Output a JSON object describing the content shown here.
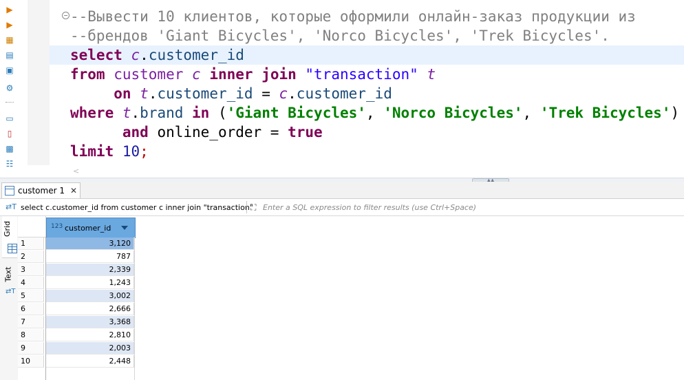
{
  "editor": {
    "lines": [
      [
        [
          "c-com",
          "--Вывести 10 клиентов, которые оформили онлайн-заказ продукции из"
        ]
      ],
      [
        [
          "c-com",
          "--брендов 'Giant Bicycles', 'Norco Bicycles', 'Trek Bicycles'."
        ]
      ],
      [
        [
          "c-kw",
          "select "
        ],
        [
          "c-al",
          "c"
        ],
        [
          "c-pl",
          "."
        ],
        [
          "c-fld",
          "customer_id"
        ]
      ],
      [
        [
          "c-kw",
          "from "
        ],
        [
          "c-tbl",
          "customer "
        ],
        [
          "c-al",
          "c "
        ],
        [
          "c-kw",
          "inner join "
        ],
        [
          "c-str",
          "\"transaction\" "
        ],
        [
          "c-al",
          "t"
        ]
      ],
      [
        [
          "c-pl",
          "     "
        ],
        [
          "c-kw",
          "on "
        ],
        [
          "c-al",
          "t"
        ],
        [
          "c-pl",
          "."
        ],
        [
          "c-fld",
          "customer_id"
        ],
        [
          "c-pl",
          " = "
        ],
        [
          "c-al",
          "c"
        ],
        [
          "c-pl",
          "."
        ],
        [
          "c-fld",
          "customer_id"
        ]
      ],
      [
        [
          "c-kw",
          "where "
        ],
        [
          "c-al",
          "t"
        ],
        [
          "c-pl",
          "."
        ],
        [
          "c-fld",
          "brand "
        ],
        [
          "c-kw",
          "in "
        ],
        [
          "c-pl",
          "("
        ],
        [
          "c-bstr",
          "'Giant Bicycles'"
        ],
        [
          "c-pl",
          ", "
        ],
        [
          "c-bstr",
          "'Norco Bicycles'"
        ],
        [
          "c-pl",
          ", "
        ],
        [
          "c-bstr",
          "'Trek Bicycles'"
        ],
        [
          "c-pl",
          ")"
        ]
      ],
      [
        [
          "c-pl",
          "      "
        ],
        [
          "c-kw",
          "and "
        ],
        [
          "c-pl",
          "online_order = "
        ],
        [
          "c-kw",
          "true"
        ]
      ],
      [
        [
          "c-kw",
          "limit "
        ],
        [
          "c-num",
          "10"
        ],
        [
          "c-red",
          ";"
        ]
      ]
    ]
  },
  "results": {
    "tab_label": "customer 1",
    "tab_close": "✕",
    "query_text": "select c.customer_id from customer c inner join \"transaction\"",
    "filter_placeholder": "Enter a SQL expression to filter results (use Ctrl+Space)",
    "side_tabs": {
      "grid": "Grid",
      "text": "Text"
    },
    "column_header": "customer_id",
    "column_type_icon": "123",
    "rows": [
      {
        "num": "1",
        "value": "3,120"
      },
      {
        "num": "2",
        "value": "787"
      },
      {
        "num": "3",
        "value": "2,339"
      },
      {
        "num": "4",
        "value": "1,243"
      },
      {
        "num": "5",
        "value": "3,002"
      },
      {
        "num": "6",
        "value": "2,666"
      },
      {
        "num": "7",
        "value": "3,368"
      },
      {
        "num": "8",
        "value": "2,810"
      },
      {
        "num": "9",
        "value": "2,003"
      },
      {
        "num": "10",
        "value": "2,448"
      }
    ]
  },
  "toolbar_icons": [
    "run-icon",
    "run-script-icon",
    "explain-icon",
    "script-icon",
    "console-icon",
    "settings-icon",
    "export-icon",
    "import-icon",
    "format-icon",
    "outline-icon"
  ],
  "colors": {
    "accent": "#2b7bb9",
    "selected_cell": "#8fb8e4",
    "alt_row": "#dde6f4",
    "header": "#6aa8e0"
  }
}
